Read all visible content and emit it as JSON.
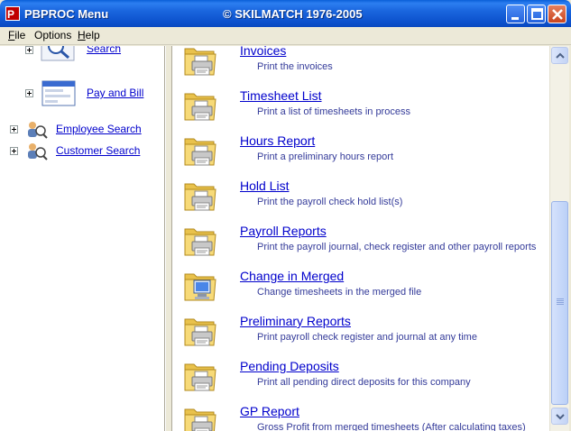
{
  "window": {
    "title_left": "PBPROC Menu",
    "title_center": "© SKILMATCH 1976-2005"
  },
  "menu": [
    {
      "label": "File",
      "key": "F",
      "rest": "ile"
    },
    {
      "label": "Options",
      "key": "",
      "rest": "Options"
    },
    {
      "label": "Help",
      "key": "H",
      "rest": "elp"
    }
  ],
  "tree": {
    "items": [
      {
        "label": "Search",
        "icon": "magnifier-icon"
      },
      {
        "label": "Pay and Bill",
        "icon": "window-form-icon"
      },
      {
        "label": "Employee Search",
        "icon": "people-search-icon"
      },
      {
        "label": "Customer Search",
        "icon": "people-search-icon"
      }
    ]
  },
  "reports": {
    "items": [
      {
        "title": "Invoices",
        "desc": "Print the invoices",
        "icon": "folder-printer-icon"
      },
      {
        "title": "Timesheet List",
        "desc": "Print a list of timesheets in process",
        "icon": "folder-printer-icon"
      },
      {
        "title": "Hours Report",
        "desc": "Print a preliminary hours report",
        "icon": "folder-printer-icon"
      },
      {
        "title": "Hold List",
        "desc": "Print the payroll check hold list(s)",
        "icon": "folder-printer-icon"
      },
      {
        "title": "Payroll Reports",
        "desc": "Print the payroll journal, check register and other payroll reports",
        "icon": "folder-printer-icon"
      },
      {
        "title": "Change in Merged",
        "desc": "Change timesheets in the merged file",
        "icon": "folder-computer-icon"
      },
      {
        "title": "Preliminary Reports",
        "desc": "Print payroll check register and journal at any time",
        "icon": "folder-printer-icon"
      },
      {
        "title": "Pending Deposits",
        "desc": "Print all pending direct deposits for this company",
        "icon": "folder-printer-icon"
      },
      {
        "title": "GP Report",
        "desc": "Gross Profit from merged timesheets (After calculating taxes)",
        "icon": "folder-printer-icon"
      }
    ]
  },
  "colors": {
    "titlebar": "#0A5FD8",
    "link": "#0000CC",
    "description": "#333A99"
  }
}
